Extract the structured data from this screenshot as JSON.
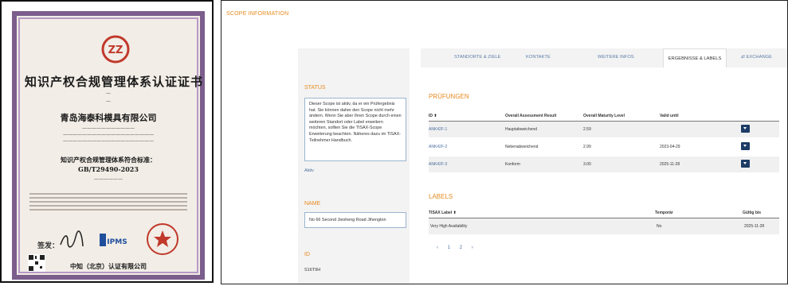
{
  "certificate": {
    "title": "知识产权合规管理体系认证证书",
    "company": "青岛海泰科模具有限公司",
    "standard_label": "知识产权合规管理体系符合标准：",
    "standard": "GB/T29490-2023",
    "signature_label": "签发：",
    "issuer": "中知（北京）认证有限公司",
    "ipms_mark": "IPMS"
  },
  "scope": {
    "title": "SCOPE INFORMATION"
  },
  "status": {
    "label": "STATUS",
    "text": "Dieser Scope ist aktiv, da er ein Prüfergebnis hat. Sie können daher den Scope nicht mehr ändern. Wenn Sie aber Ihren Scope durch einen weiteren Standort oder Label erweitern möchten, sollten Sie die TISAX-Scope Erweiterung beachten. Näheres dazu im TISAX-Teilnehmer Handbuch.",
    "link": "Aktiv"
  },
  "name": {
    "label": "NAME",
    "value": "No 66 Second Jiesheng Road Jihengton"
  },
  "id": {
    "label": "ID",
    "value": "S16T9H"
  },
  "tabs": [
    {
      "label": "STANDORTE & ZIELE",
      "active": false
    },
    {
      "label": "KONTAKTE",
      "active": false
    },
    {
      "label": "WEITERE INFOS",
      "active": false
    },
    {
      "label": "ERGEBNISSE & LABELS",
      "active": true
    },
    {
      "label": "EXCHANGE",
      "active": false
    }
  ],
  "pruefungen": {
    "heading": "PRÜFUNGEN",
    "columns": [
      "ID",
      "Overall Assessment Result",
      "Overall Maturity Level",
      "Valid until"
    ],
    "rows": [
      {
        "id": "ANK42F-1",
        "result": "Hauptabweichend",
        "maturity": "2.59",
        "valid": ""
      },
      {
        "id": "ANK42F-2",
        "result": "Nebenabweichend",
        "maturity": "2.99",
        "valid": "2023-04-29"
      },
      {
        "id": "ANK42F-3",
        "result": "Konform",
        "maturity": "3.00",
        "valid": "2025-11-28"
      }
    ]
  },
  "labels": {
    "heading": "LABELS",
    "columns": [
      "TISAX Label",
      "Temporär",
      "Gültig bis"
    ],
    "rows": [
      {
        "label": "Very High Availability",
        "temp": "No",
        "valid": "2025-11-28"
      }
    ]
  },
  "pager": [
    "‹",
    "1",
    "2",
    "›"
  ]
}
